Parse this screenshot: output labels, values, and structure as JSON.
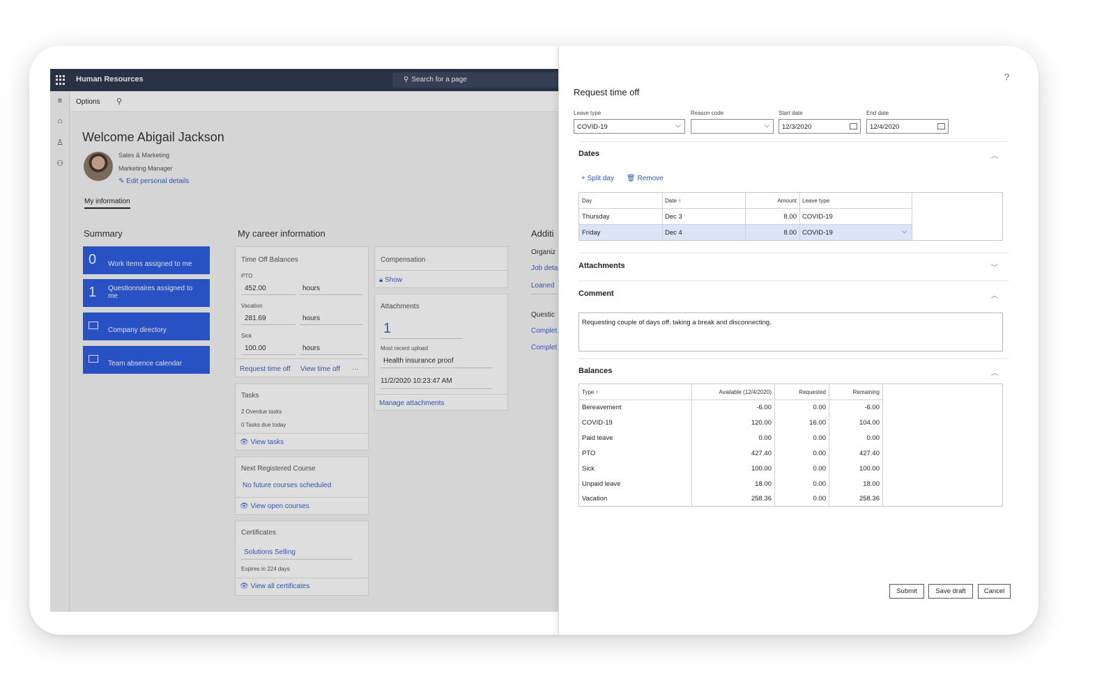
{
  "app": {
    "title": "Human Resources",
    "search_placeholder": "Search for a page",
    "options_label": "Options"
  },
  "profile": {
    "welcome": "Welcome Abigail Jackson",
    "department": "Sales & Marketing",
    "job_title": "Marketing Manager",
    "edit_link": "Edit personal details",
    "tab": "My information"
  },
  "summary": {
    "heading": "Summary",
    "tiles": [
      {
        "count": "0",
        "label": "Work items assigned to me"
      },
      {
        "count": "1",
        "label": "Questionnaires assigned to me"
      },
      {
        "label": "Company directory",
        "icon": "list-icon"
      },
      {
        "label": "Team absence calendar",
        "icon": "calendar-icon"
      }
    ]
  },
  "career": {
    "heading": "My career information",
    "time_off": {
      "title": "Time Off Balances",
      "rows": [
        {
          "label": "PTO",
          "value": "452.00",
          "unit": "hours"
        },
        {
          "label": "Vacation",
          "value": "281.69",
          "unit": "hours"
        },
        {
          "label": "Sick",
          "value": "100.00",
          "unit": "hours"
        }
      ],
      "link_request": "Request time off",
      "link_view": "View time off",
      "more": "···"
    },
    "tasks": {
      "title": "Tasks",
      "line1": "2 Overdue tasks",
      "line2": "0 Tasks due today",
      "link": "View tasks"
    },
    "course": {
      "title": "Next Registered Course",
      "value": "No future courses scheduled",
      "link": "View open courses"
    },
    "certificates": {
      "title": "Certificates",
      "value": "Solutions Selling",
      "expires": "Expires in 224 days",
      "link": "View all certificates"
    },
    "compensation": {
      "title": "Compensation",
      "show": "Show"
    },
    "attachments": {
      "title": "Attachments",
      "count": "1",
      "recent_label": "Most recent upload",
      "recent_name": "Health insurance proof",
      "recent_time": "11/2/2020 10:23:47 AM",
      "link": "Manage attachments"
    }
  },
  "additional": {
    "heading": "Additi",
    "org": "Organiz",
    "job": "Job deta",
    "loaned": "Loaned",
    "quest": "Questic",
    "complete1": "Complet",
    "complete2": "Complet"
  },
  "dialog": {
    "title": "Request time off",
    "help": "?",
    "fields": {
      "leave_type_label": "Leave type",
      "leave_type_value": "COVID-19",
      "reason_label": "Reason code",
      "reason_value": "",
      "start_label": "Start date",
      "start_value": "12/3/2020",
      "end_label": "End date",
      "end_value": "12/4/2020"
    },
    "dates": {
      "heading": "Dates",
      "split_day": "Split day",
      "remove": "Remove",
      "columns": [
        "Day",
        "Date",
        "Amount",
        "Leave type"
      ],
      "sort_arrow": "↑",
      "rows": [
        {
          "day": "Thursday",
          "date": "Dec 3",
          "amount": "8.00",
          "leave_type": "COVID-19"
        },
        {
          "day": "Friday",
          "date": "Dec 4",
          "amount": "8.00",
          "leave_type": "COVID-19"
        }
      ]
    },
    "attachments_heading": "Attachments",
    "comment": {
      "heading": "Comment",
      "text": "Requesting couple of days off, taking a break and disconnecting."
    },
    "balances": {
      "heading": "Balances",
      "columns": [
        "Type",
        "Available (12/4/2020)",
        "Requested",
        "Remaining"
      ],
      "sort_arrow": "↑",
      "rows": [
        {
          "type": "Bereavement",
          "available": "-6.00",
          "requested": "0.00",
          "remaining": "-6.00"
        },
        {
          "type": "COVID-19",
          "available": "120.00",
          "requested": "16.00",
          "remaining": "104.00"
        },
        {
          "type": "Paid leave",
          "available": "0.00",
          "requested": "0.00",
          "remaining": "0.00"
        },
        {
          "type": "PTO",
          "available": "427.40",
          "requested": "0.00",
          "remaining": "427.40"
        },
        {
          "type": "Sick",
          "available": "100.00",
          "requested": "0.00",
          "remaining": "100.00"
        },
        {
          "type": "Unpaid leave",
          "available": "18.00",
          "requested": "0.00",
          "remaining": "18.00"
        },
        {
          "type": "Vacation",
          "available": "258.36",
          "requested": "0.00",
          "remaining": "258.36"
        }
      ]
    },
    "buttons": {
      "submit": "Submit",
      "save_draft": "Save draft",
      "cancel": "Cancel"
    }
  }
}
